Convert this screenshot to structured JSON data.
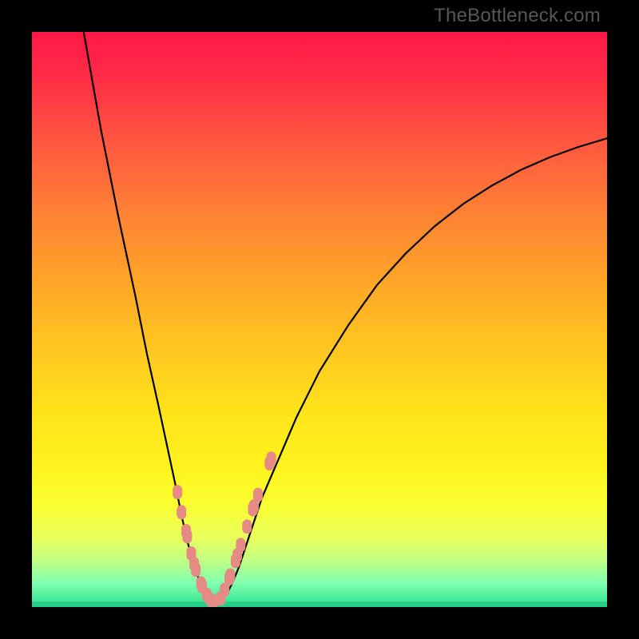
{
  "watermark": "TheBottleneck.com",
  "chart_data": {
    "type": "line",
    "title": "",
    "xlabel": "",
    "ylabel": "",
    "xlim": [
      0,
      100
    ],
    "ylim": [
      0,
      100
    ],
    "series": [
      {
        "name": "curve-left",
        "x": [
          9,
          12,
          15,
          18,
          20,
          22,
          23.5,
          25,
          26,
          27,
          28,
          28.8,
          29.5,
          30,
          30.5,
          31,
          31.5,
          32
        ],
        "values": [
          100,
          83,
          68,
          54,
          44,
          35,
          28,
          21,
          16,
          11.5,
          8,
          5.5,
          3.5,
          2.3,
          1.6,
          1.1,
          0.7,
          0.5
        ]
      },
      {
        "name": "curve-right",
        "x": [
          32,
          33,
          34,
          35,
          36,
          38,
          40,
          43,
          46,
          50,
          55,
          60,
          65,
          70,
          75,
          80,
          85,
          90,
          95,
          100
        ],
        "values": [
          0.5,
          1.2,
          2.5,
          4.5,
          7,
          13,
          19,
          26,
          33,
          41,
          49,
          56,
          61.5,
          66.2,
          70.1,
          73.3,
          76,
          78.2,
          80,
          81.5
        ]
      }
    ],
    "markers": {
      "name": "data-points",
      "x": [
        25.3,
        26.0,
        26.8,
        27.0,
        27.7,
        28.2,
        28.5,
        29.4,
        29.6,
        30.4,
        31.0,
        31.5,
        32.8,
        33.5,
        34.3,
        34.5,
        35.4,
        35.7,
        36.3,
        37.4,
        38.4,
        38.6,
        39.3,
        41.3,
        41.6
      ],
      "values": [
        20.0,
        16.5,
        13.2,
        12.3,
        9.3,
        7.5,
        6.5,
        4.1,
        3.6,
        2.1,
        1.3,
        0.9,
        1.5,
        3.0,
        5.0,
        5.5,
        8.0,
        9.0,
        10.8,
        14.0,
        17.0,
        17.5,
        19.5,
        25.0,
        25.8
      ]
    },
    "baseline": {
      "name": "baseline",
      "y": 0.5
    }
  }
}
